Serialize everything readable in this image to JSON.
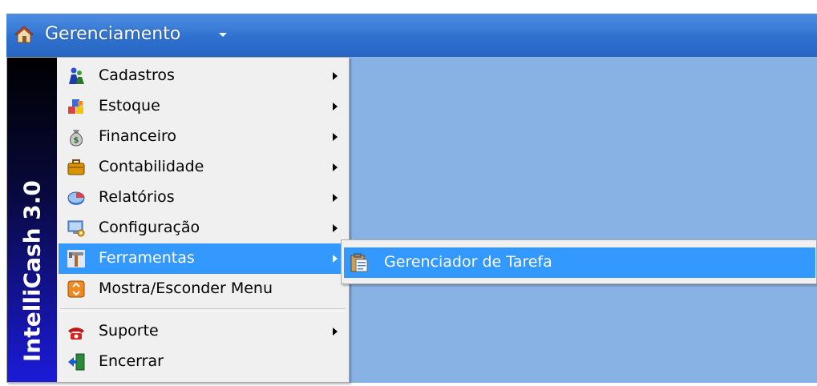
{
  "menubar": {
    "title": "Gerenciamento",
    "home_icon": "home-icon",
    "dropdown_icon": "chevron-down-icon"
  },
  "menu": {
    "sidebar_text": "IntelliCash 3.0",
    "items": [
      {
        "label": "Cadastros",
        "icon": "people-icon",
        "has_submenu": true
      },
      {
        "label": "Estoque",
        "icon": "boxes-icon",
        "has_submenu": true
      },
      {
        "label": "Financeiro",
        "icon": "money-bag-icon",
        "has_submenu": true
      },
      {
        "label": "Contabilidade",
        "icon": "briefcase-icon",
        "has_submenu": true
      },
      {
        "label": "Relatórios",
        "icon": "pie-chart-icon",
        "has_submenu": true
      },
      {
        "label": "Configuração",
        "icon": "computer-settings-icon",
        "has_submenu": true
      },
      {
        "label": "Ferramentas",
        "icon": "tools-icon",
        "has_submenu": true,
        "highlighted": true
      },
      {
        "label": "Mostra/Esconder Menu",
        "icon": "toggle-menu-icon",
        "has_submenu": false
      },
      {
        "label": "Suporte",
        "icon": "telephone-icon",
        "has_submenu": true
      },
      {
        "label": "Encerrar",
        "icon": "exit-door-icon",
        "has_submenu": false
      }
    ]
  },
  "submenu": {
    "items": [
      {
        "label": "Gerenciador de Tarefa",
        "icon": "clipboard-task-icon",
        "highlighted": true
      }
    ]
  },
  "colors": {
    "menubar": "#2f71cf",
    "workspace": "#89b2e4",
    "highlight": "#3399ff",
    "menu_background": "#f0f0f0",
    "sidebar_bottom": "#1b1bd9"
  }
}
